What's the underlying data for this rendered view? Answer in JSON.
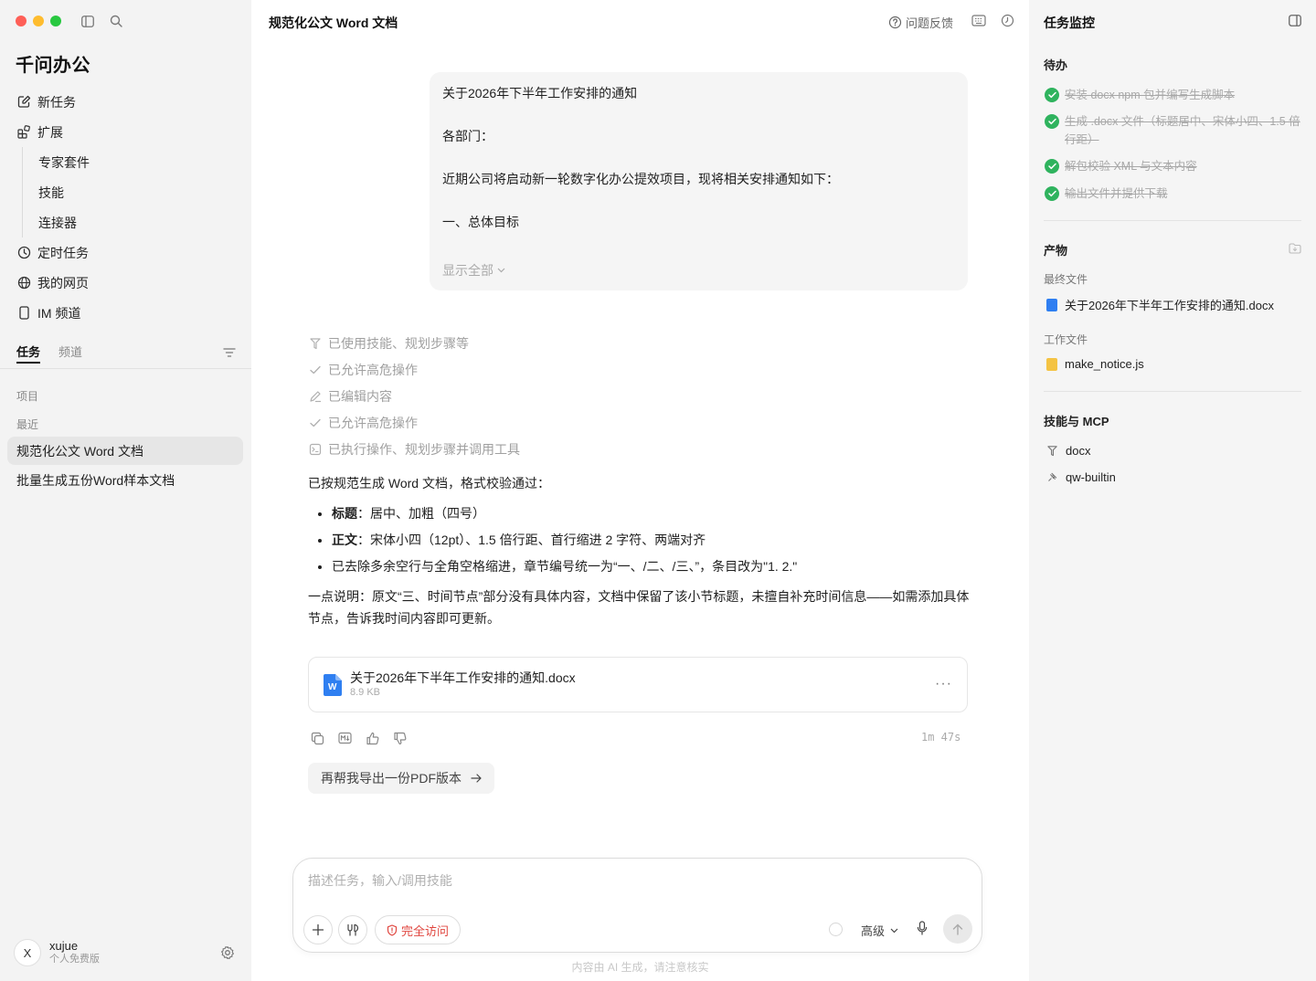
{
  "sidebar": {
    "brand": "千问办公",
    "nav": {
      "new_task": "新任务",
      "extensions": "扩展",
      "expert_suite": "专家套件",
      "skills": "技能",
      "connectors": "连接器",
      "scheduled": "定时任务",
      "my_pages": "我的网页",
      "im_channel": "IM 频道"
    },
    "tabs": {
      "tasks": "任务",
      "channels": "频道"
    },
    "labels": {
      "projects": "项目",
      "recent": "最近"
    },
    "tasks": [
      "规范化公文 Word 文档",
      "批量生成五份Word样本文档"
    ],
    "user": {
      "avatar_letter": "X",
      "name": "xujue",
      "plan": "个人免费版"
    }
  },
  "header": {
    "title": "规范化公文 Word 文档",
    "feedback": "问题反馈"
  },
  "chat": {
    "user_message": {
      "paragraphs": [
        "关于2026年下半年工作安排的通知",
        "各部门：",
        "近期公司将启动新一轮数字化办公提效项目，现将相关安排通知如下：",
        "一、总体目标"
      ],
      "show_all": "显示全部"
    },
    "steps": [
      "已使用技能、规划步骤等",
      "已允许高危操作",
      "已编辑内容",
      "已允许高危操作",
      "已执行操作、规划步骤并调用工具"
    ],
    "answer": {
      "lead": "已按规范生成 Word 文档，格式校验通过：",
      "bullets": [
        {
          "label": "标题",
          "text": "：居中、加粗（四号）"
        },
        {
          "label": "正文",
          "text": "：宋体小四（12pt）、1.5 倍行距、首行缩进 2 字符、两端对齐"
        },
        {
          "label": "",
          "text": "已去除多余空行与全角空格缩进，章节编号统一为“一、/二、/三、”，条目改为\"1. 2.\""
        }
      ],
      "note": "一点说明：原文“三、时间节点”部分没有具体内容，文档中保留了该小节标题，未擅自补充时间信息——如需添加具体节点，告诉我时间内容即可更新。"
    },
    "file": {
      "name": "关于2026年下半年工作安排的通知.docx",
      "size": "8.9 KB",
      "icon_letter": "W"
    },
    "elapsed": "1m 47s",
    "suggestion": "再帮我导出一份PDF版本"
  },
  "composer": {
    "placeholder": "描述任务，输入/调用技能",
    "access_label": "完全访问",
    "model_label": "高级"
  },
  "disclaimer": "内容由 AI 生成，请注意核实",
  "right_panel": {
    "title": "任务监控",
    "todo_title": "待办",
    "todos": [
      "安装 docx npm 包并编写生成脚本",
      "生成 .docx 文件（标题居中、宋体小四、1.5 倍行距）",
      "解包校验 XML 与文本内容",
      "输出文件并提供下载"
    ],
    "artifacts_title": "产物",
    "final_files_label": "最终文件",
    "final_file": "关于2026年下半年工作安排的通知.docx",
    "work_files_label": "工作文件",
    "work_file": "make_notice.js",
    "skills_title": "技能与 MCP",
    "skills": [
      "docx",
      "qw-builtin"
    ]
  },
  "colors": {
    "accent_green": "#2fb35e",
    "danger_red": "#e0463f",
    "word_blue": "#2f7ff1",
    "js_yellow": "#f4c343"
  }
}
